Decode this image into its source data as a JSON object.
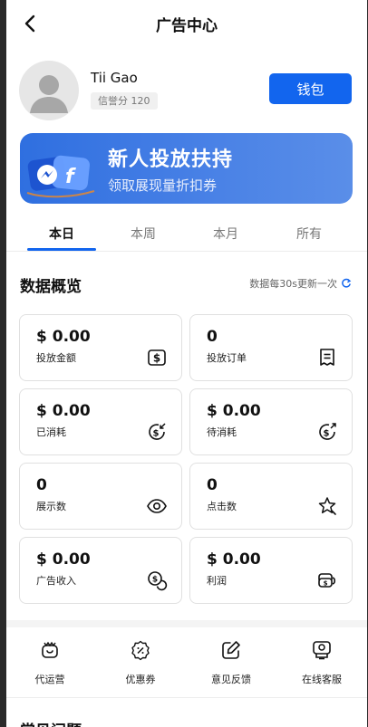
{
  "header": {
    "title": "广告中心",
    "back_icon": "back-chevron-icon"
  },
  "profile": {
    "name": "Tii Gao",
    "credit": "信誉分 120",
    "wallet_label": "钱包"
  },
  "banner": {
    "title": "新人投放扶持",
    "subtitle": "领取展现量折扣券",
    "bg_color": "#3d78e3"
  },
  "tabs": [
    {
      "label": "本日",
      "active": true
    },
    {
      "label": "本周",
      "active": false
    },
    {
      "label": "本月",
      "active": false
    },
    {
      "label": "所有",
      "active": false
    }
  ],
  "overview": {
    "title": "数据概览",
    "update_note": "数据每30s更新一次",
    "cards": [
      {
        "value": "$ 0.00",
        "label": "投放金额",
        "icon": "dollar-square-icon"
      },
      {
        "value": "0",
        "label": "投放订单",
        "icon": "order-receipt-icon"
      },
      {
        "value": "$ 0.00",
        "label": "已消耗",
        "icon": "dollar-consumed-icon"
      },
      {
        "value": "$ 0.00",
        "label": "待消耗",
        "icon": "dollar-pending-icon"
      },
      {
        "value": "0",
        "label": "展示数",
        "icon": "eye-icon"
      },
      {
        "value": "0",
        "label": "点击数",
        "icon": "click-star-icon"
      },
      {
        "value": "$ 0.00",
        "label": "广告收入",
        "icon": "coins-icon"
      },
      {
        "value": "$ 0.00",
        "label": "利润",
        "icon": "money-stack-icon"
      }
    ]
  },
  "services": [
    {
      "label": "代运营",
      "icon": "wallet-smile-icon"
    },
    {
      "label": "优惠券",
      "icon": "coupon-badge-icon"
    },
    {
      "label": "意见反馈",
      "icon": "edit-feedback-icon"
    },
    {
      "label": "在线客服",
      "icon": "customer-service-icon"
    }
  ],
  "faq": {
    "title": "常见问题"
  },
  "colors": {
    "accent": "#1265ee"
  }
}
